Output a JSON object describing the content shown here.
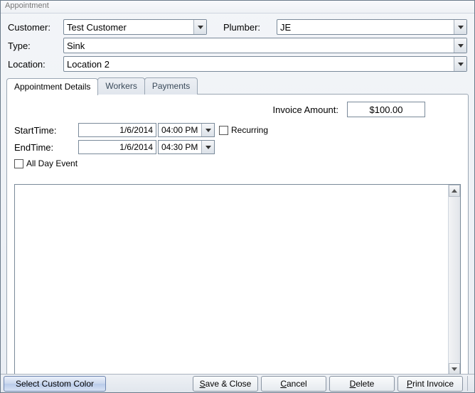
{
  "window": {
    "title": "Appointment"
  },
  "header": {
    "customer_label": "Customer:",
    "plumber_label": "Plumber:",
    "type_label": "Type:",
    "location_label": "Location:",
    "customer_value": "Test Customer",
    "plumber_value": "JE",
    "type_value": "Sink",
    "location_value": "Location 2"
  },
  "tabs": {
    "details": "Appointment Details",
    "workers": "Workers",
    "payments": "Payments"
  },
  "details": {
    "invoice_label": "Invoice Amount:",
    "invoice_value": "$100.00",
    "start_label": "StartTime:",
    "start_date": "1/6/2014",
    "start_time": "04:00 PM",
    "end_label": "EndTime:",
    "end_date": "1/6/2014",
    "end_time": "04:30 PM",
    "recurring_label": "Recurring",
    "allday_label": "All Day Event",
    "notes": ""
  },
  "footer": {
    "select_color": "Select Custom Color",
    "save": "Save & Close",
    "cancel": "Cancel",
    "delete": "Delete",
    "print": "Print Invoice"
  }
}
